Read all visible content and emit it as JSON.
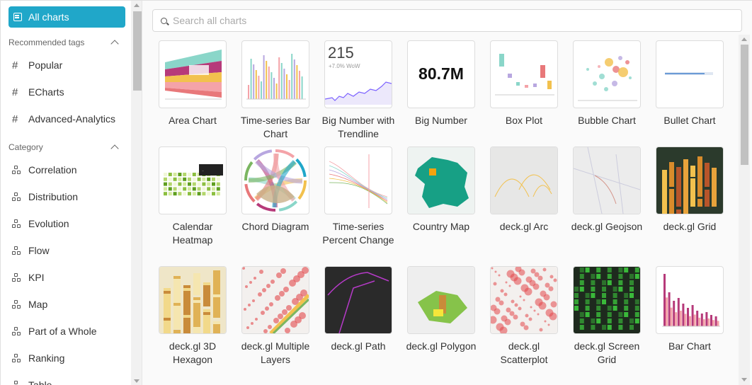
{
  "sidebar": {
    "all_charts_label": "All charts",
    "recommended_heading": "Recommended tags",
    "recommended": [
      {
        "label": "Popular"
      },
      {
        "label": "ECharts"
      },
      {
        "label": "Advanced-Analytics"
      }
    ],
    "category_heading": "Category",
    "categories": [
      {
        "label": "Correlation"
      },
      {
        "label": "Distribution"
      },
      {
        "label": "Evolution"
      },
      {
        "label": "Flow"
      },
      {
        "label": "KPI"
      },
      {
        "label": "Map"
      },
      {
        "label": "Part of a Whole"
      },
      {
        "label": "Ranking"
      },
      {
        "label": "Table"
      }
    ]
  },
  "search": {
    "placeholder": "Search all charts"
  },
  "charts": [
    {
      "label": "Area Chart",
      "thumb": "area"
    },
    {
      "label": "Time-series Bar Chart",
      "thumb": "tsbar"
    },
    {
      "label": "Big Number with Trendline",
      "thumb": "bignumtrend",
      "value": "215",
      "sub": "+7.0% WoW"
    },
    {
      "label": "Big Number",
      "thumb": "bignum",
      "value": "80.7M"
    },
    {
      "label": "Box Plot",
      "thumb": "box"
    },
    {
      "label": "Bubble Chart",
      "thumb": "bubble"
    },
    {
      "label": "Bullet Chart",
      "thumb": "bullet"
    },
    {
      "label": "Calendar Heatmap",
      "thumb": "calendar"
    },
    {
      "label": "Chord Diagram",
      "thumb": "chord"
    },
    {
      "label": "Time-series Percent Change",
      "thumb": "pct"
    },
    {
      "label": "Country Map",
      "thumb": "country"
    },
    {
      "label": "deck.gl Arc",
      "thumb": "arc"
    },
    {
      "label": "deck.gl Geojson",
      "thumb": "geojson"
    },
    {
      "label": "deck.gl Grid",
      "thumb": "grid3d"
    },
    {
      "label": "deck.gl 3D Hexagon",
      "thumb": "hex"
    },
    {
      "label": "deck.gl Multiple Layers",
      "thumb": "multi"
    },
    {
      "label": "deck.gl Path",
      "thumb": "path"
    },
    {
      "label": "deck.gl Polygon",
      "thumb": "polygon"
    },
    {
      "label": "deck.gl Scatterplot",
      "thumb": "scatter"
    },
    {
      "label": "deck.gl Screen Grid",
      "thumb": "screengrid"
    },
    {
      "label": "Bar Chart",
      "thumb": "bar"
    }
  ],
  "colors": {
    "accent": "#20a7c9"
  }
}
